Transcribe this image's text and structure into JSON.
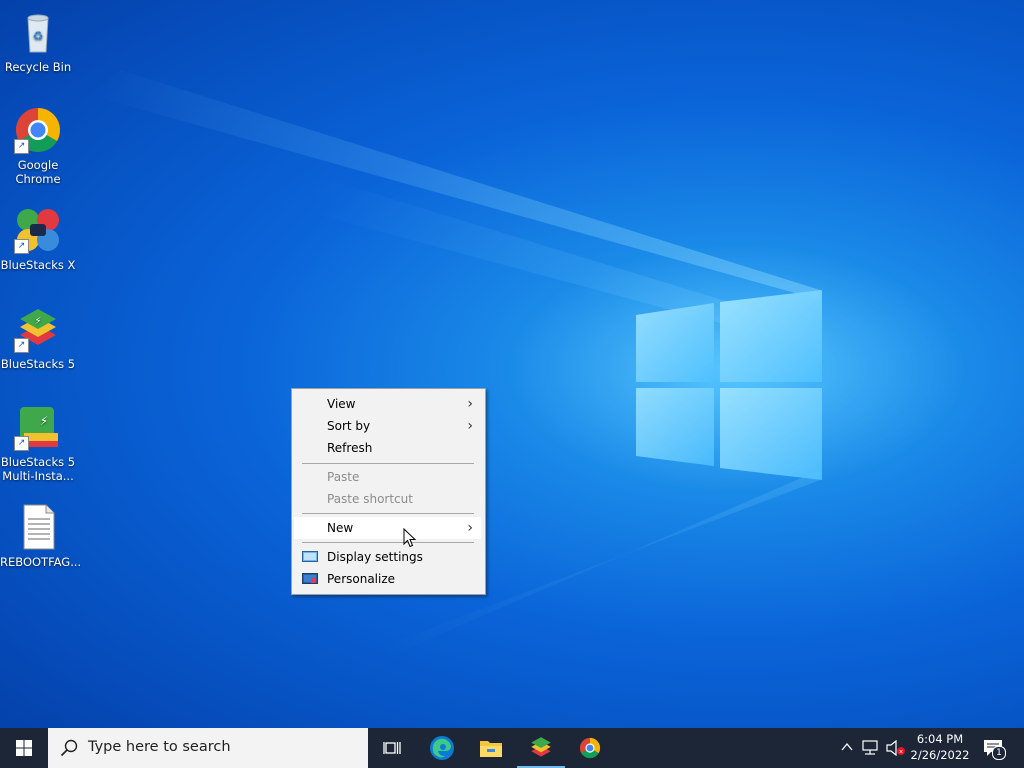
{
  "desktop": {
    "icons": [
      {
        "label": "Recycle Bin"
      },
      {
        "label": "Google\nChrome"
      },
      {
        "label": "BlueStacks X"
      },
      {
        "label": "BlueStacks 5"
      },
      {
        "label": "BlueStacks 5\nMulti-Insta..."
      },
      {
        "label": "REBOOTFAG..."
      }
    ]
  },
  "context_menu": {
    "items": [
      {
        "label": "View",
        "submenu": true,
        "enabled": true
      },
      {
        "label": "Sort by",
        "submenu": true,
        "enabled": true
      },
      {
        "label": "Refresh",
        "submenu": false,
        "enabled": true
      },
      {
        "label": "Paste",
        "submenu": false,
        "enabled": false
      },
      {
        "label": "Paste shortcut",
        "submenu": false,
        "enabled": false
      },
      {
        "label": "New",
        "submenu": true,
        "enabled": true,
        "hovered": true
      },
      {
        "label": "Display settings",
        "submenu": false,
        "enabled": true,
        "icon": "display-icon"
      },
      {
        "label": "Personalize",
        "submenu": false,
        "enabled": true,
        "icon": "personalize-icon"
      }
    ]
  },
  "taskbar": {
    "search_placeholder": "Type here to search",
    "apps": [
      "task-view",
      "microsoft-edge",
      "file-explorer",
      "bluestacks",
      "google-chrome"
    ],
    "clock_time": "6:04 PM",
    "clock_date": "2/26/2022",
    "notification_count": "1"
  },
  "colors": {
    "taskbar": "#1c2637",
    "menu_bg": "#f2f2f2",
    "desktop_accent": "#0a64d8"
  }
}
